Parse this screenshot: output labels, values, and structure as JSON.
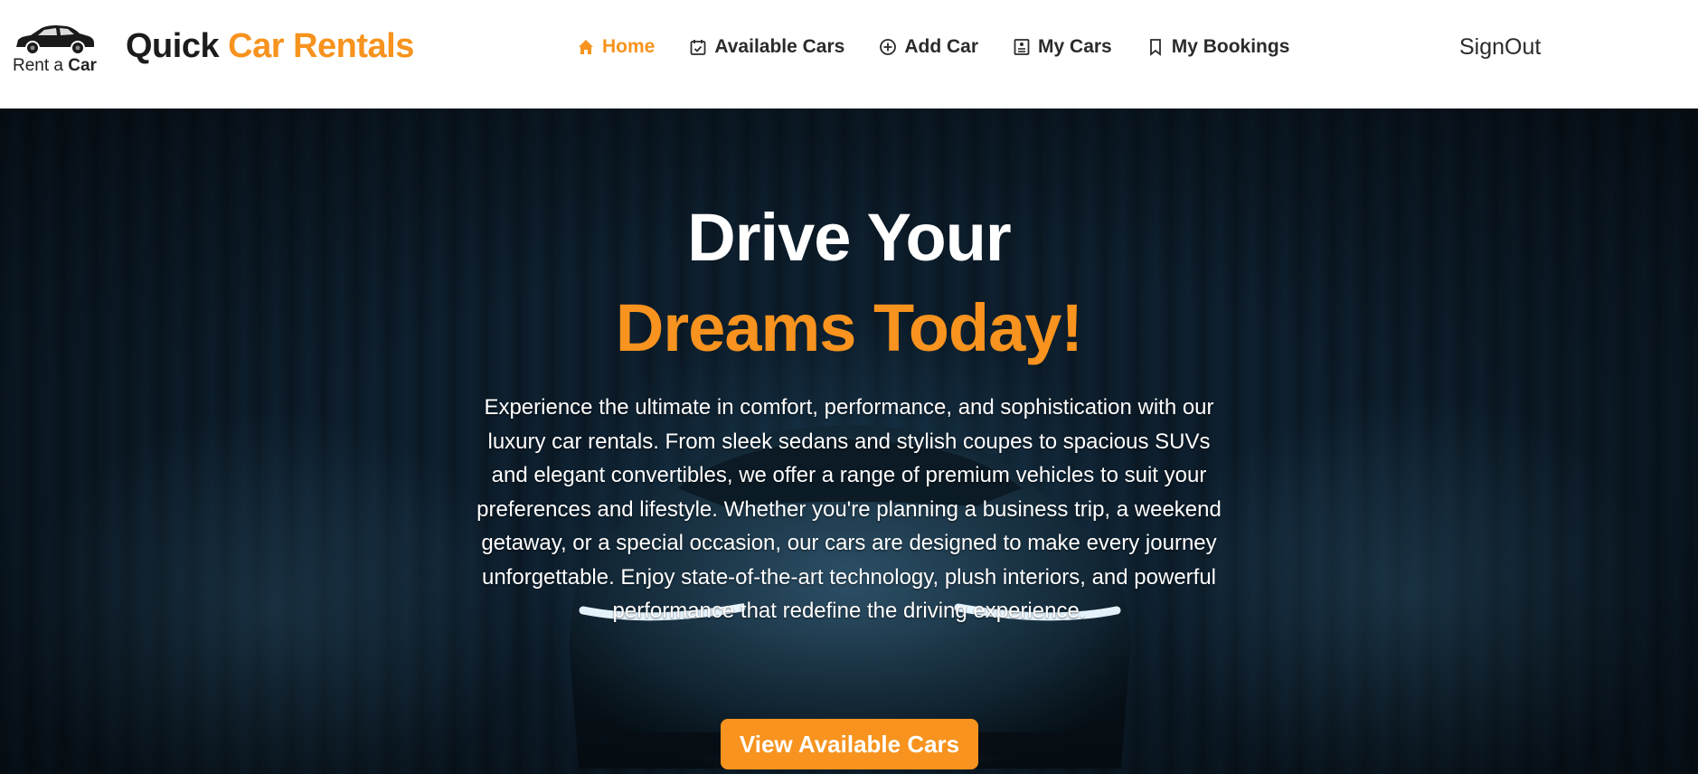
{
  "brand": {
    "logo_text_regular": "Rent a",
    "logo_text_bold": "Car",
    "name_part1": "Quick",
    "name_part2": "Car Rentals"
  },
  "nav": {
    "items": [
      {
        "label": "Home",
        "icon": "home-icon",
        "active": true
      },
      {
        "label": "Available Cars",
        "icon": "calendar-check-icon",
        "active": false
      },
      {
        "label": "Add Car",
        "icon": "plus-circle-icon",
        "active": false
      },
      {
        "label": "My Cars",
        "icon": "document-list-icon",
        "active": false
      },
      {
        "label": "My Bookings",
        "icon": "bookmark-icon",
        "active": false
      }
    ],
    "signout_label": "SignOut"
  },
  "hero": {
    "title_line1": "Drive Your",
    "title_line2": "Dreams Today!",
    "description": "Experience the ultimate in comfort, performance, and sophistication with our luxury car rentals. From sleek sedans and stylish coupes to spacious SUVs and elegant convertibles, we offer a range of premium vehicles to suit your preferences and lifestyle. Whether you're planning a business trip, a weekend getaway, or a special occasion, our cars are designed to make every journey unforgettable. Enjoy state-of-the-art technology, plush interiors, and powerful performance that redefine the driving experience.",
    "cta_label": "View Available Cars"
  },
  "colors": {
    "accent": "#f7931e",
    "hero_bg": "#0b1a26",
    "text_dark": "#2b2b2b"
  }
}
